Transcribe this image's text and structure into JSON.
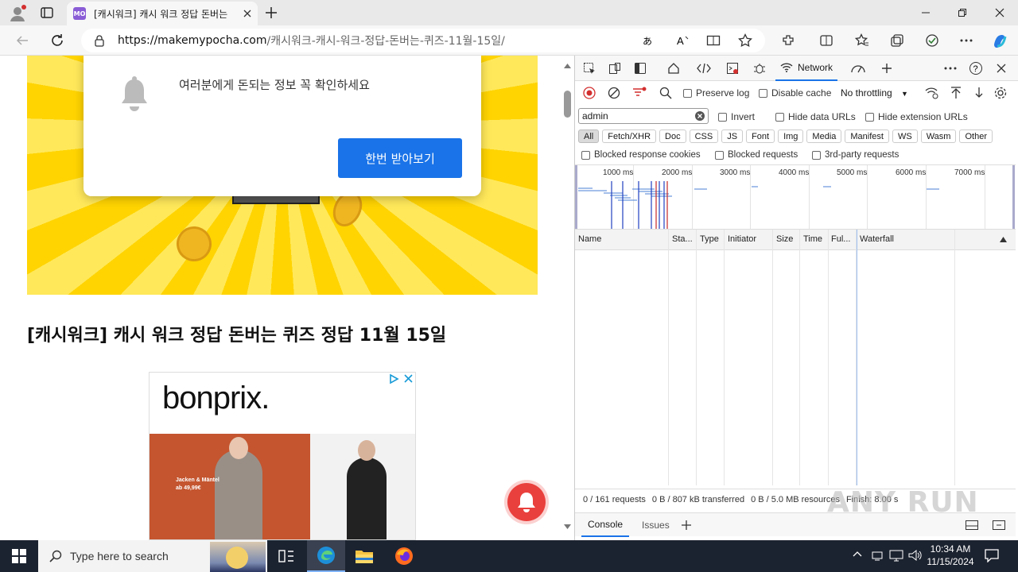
{
  "browser": {
    "tab_title": "[캐시워크] 캐시 워크 정답 돈버는",
    "tab_favicon_text": "MO",
    "url_host": "https://makemypocha.com",
    "url_path": "/캐시워크-캐시-워크-정답-돈버는-퀴즈-11월-15일/"
  },
  "page": {
    "popup_message": "여러분에게 돈되는 정보 꼭 확인하세요",
    "popup_button": "한번 받아보기",
    "headline": "[캐시워크] 캐시 워크 정답 돈버는 퀴즈 정답 11월 15일",
    "ad_brand": "bonprix.",
    "ad_caption": "Jacken & Mäntel\nab 49,99€"
  },
  "devtools": {
    "active_panel": "Network",
    "preserve_log": "Preserve log",
    "disable_cache": "Disable cache",
    "throttling": "No throttling",
    "filter_value": "admin",
    "invert": "Invert",
    "hide_data_urls": "Hide data URLs",
    "hide_extension_urls": "Hide extension URLs",
    "type_filters": [
      "All",
      "Fetch/XHR",
      "Doc",
      "CSS",
      "JS",
      "Font",
      "Img",
      "Media",
      "Manifest",
      "WS",
      "Wasm",
      "Other"
    ],
    "blocked_response_cookies": "Blocked response cookies",
    "blocked_requests": "Blocked requests",
    "third_party_requests": "3rd-party requests",
    "timeline_ticks": [
      "1000 ms",
      "2000 ms",
      "3000 ms",
      "4000 ms",
      "5000 ms",
      "6000 ms",
      "7000 ms"
    ],
    "columns": [
      "Name",
      "Sta...",
      "Type",
      "Initiator",
      "Size",
      "Time",
      "Ful...",
      "Waterfall"
    ],
    "status_requests": "0 / 161 requests",
    "status_transferred": "0 B / 807 kB transferred",
    "status_resources": "0 B / 5.0 MB resources",
    "status_finish": "Finish: 8.00 s",
    "drawer_tabs": [
      "Console",
      "Issues"
    ]
  },
  "taskbar": {
    "search_placeholder": "Type here to search",
    "time": "10:34 AM",
    "date": "11/15/2024"
  },
  "watermark": "ANY RUN"
}
